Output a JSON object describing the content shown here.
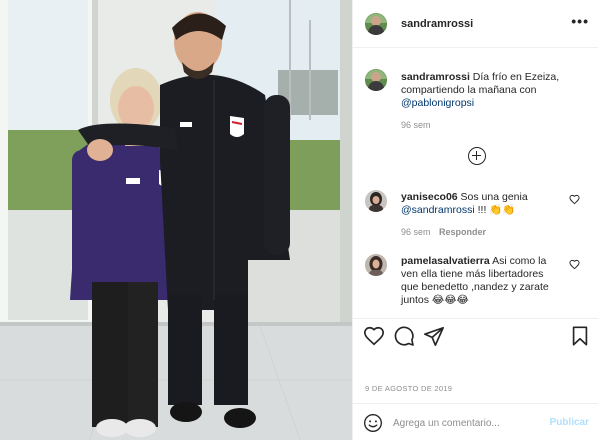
{
  "post": {
    "username": "sandramrossi",
    "more_icon": "more-horizontal-icon"
  },
  "caption": {
    "username": "sandramrossi",
    "text_line1": "Día frío en Ezeiza,",
    "text_line2": "compartiendo la mañana con",
    "mention": "@pablonigropsi",
    "time": "96 sem"
  },
  "comments": [
    {
      "username": "yaniseco06",
      "text": "Sos una genia",
      "mention": "@sandramrossi",
      "suffix": "!!! 👏👏",
      "time": "96 sem",
      "reply": "Responder"
    },
    {
      "username": "pamelasalvatierra",
      "text_line1": "Asi como la",
      "text_line2": "ven ella tiene más libertadores",
      "text_line3": "que benedetto ,nandez y zarate",
      "text_line4": "juntos 😂😂😂"
    }
  ],
  "date": "9 DE AGOSTO DE 2019",
  "comment_box": {
    "placeholder": "Agrega un comentario...",
    "publish": "Publicar"
  },
  "colors": {
    "link": "#00376b",
    "muted": "#8e8e8e",
    "publish_disabled": "#b2dffc",
    "border": "#efefef"
  }
}
